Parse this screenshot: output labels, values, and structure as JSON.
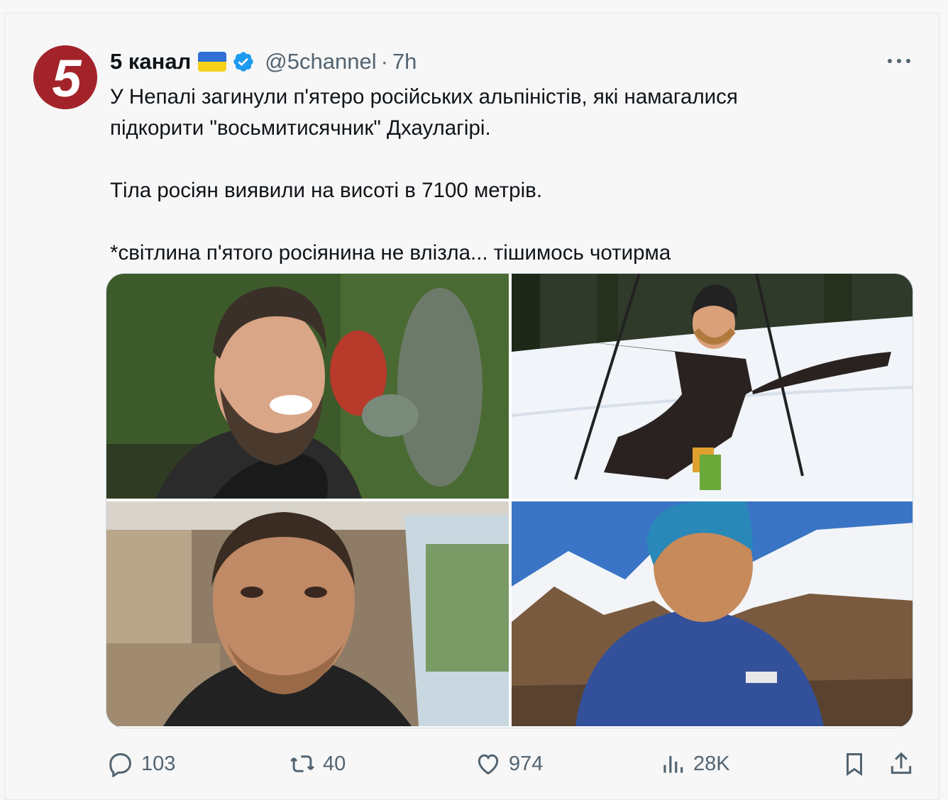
{
  "post": {
    "author_name": "5 канал",
    "handle": "@5channel",
    "separator": "·",
    "time": "7h",
    "avatar_text": "5",
    "text_lines": [
      "У Непалі загинули п'ятеро російських альпіністів, які намагалися",
      "підкорити \"восьмитисячник\" Дхаулагірі.",
      "Тіла росіян виявили на висоті в 7100 метрів.",
      "*світлина п'ятого росіянина не влізла... тішимось чотирма"
    ]
  },
  "icons": {
    "flag": "ukraine-flag-icon",
    "verified": "verified-badge-icon",
    "more": "more-options-icon",
    "reply": "reply-icon",
    "repost": "repost-icon",
    "like": "like-icon",
    "views": "views-icon",
    "bookmark": "bookmark-icon",
    "share": "share-icon"
  },
  "media": {
    "photo_count": 4
  },
  "actions": {
    "reply_count": "103",
    "repost_count": "40",
    "like_count": "974",
    "views_count": "28K"
  },
  "colors": {
    "text": "#0f1419",
    "muted": "#536471",
    "verified": "#1d9bf0",
    "avatar_bg": "#a3232a"
  }
}
